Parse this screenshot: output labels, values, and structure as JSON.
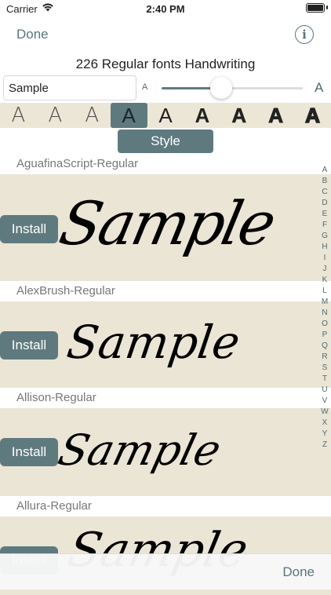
{
  "status": {
    "carrier": "Carrier",
    "time": "2:40 PM"
  },
  "nav": {
    "done_label": "Done",
    "info_label": "i"
  },
  "page": {
    "title": "226 Regular fonts Handwriting"
  },
  "sample": {
    "value": "Sample"
  },
  "size_slider": {
    "small_label": "A",
    "large_label": "A",
    "value_fraction": 0.42
  },
  "weights": {
    "glyph": "A",
    "count": 9,
    "selected_index": 3
  },
  "style_button": {
    "label": "Style"
  },
  "fonts": [
    {
      "name": "AguafinaScript-Regular",
      "sample": "Sample",
      "install": "Install"
    },
    {
      "name": "AlexBrush-Regular",
      "sample": "Sample",
      "install": "Install"
    },
    {
      "name": "Allison-Regular",
      "sample": "Sample",
      "install": "Install"
    },
    {
      "name": "Allura-Regular",
      "sample": "Sample",
      "install": "Install"
    }
  ],
  "alphabet": [
    "A",
    "B",
    "C",
    "D",
    "E",
    "F",
    "G",
    "H",
    "I",
    "J",
    "K",
    "L",
    "M",
    "N",
    "O",
    "P",
    "Q",
    "R",
    "S",
    "T",
    "U",
    "V",
    "W",
    "X",
    "Y",
    "Z"
  ],
  "bottom": {
    "done_label": "Done"
  },
  "colors": {
    "accent": "#5f7a7f",
    "panel": "#ebe5d6"
  }
}
